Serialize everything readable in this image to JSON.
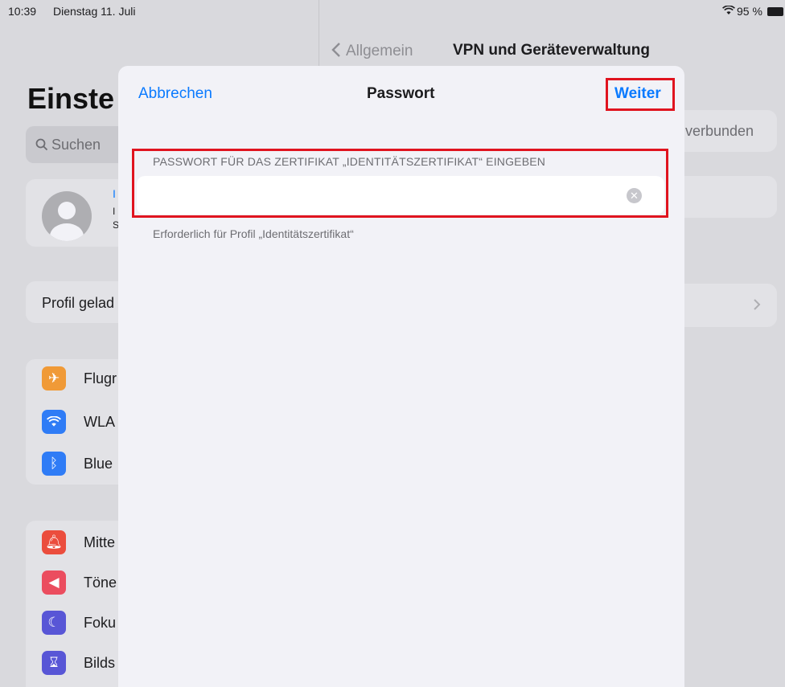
{
  "status_bar": {
    "time": "10:39",
    "date": "Dienstag 11. Juli",
    "battery": "95 %"
  },
  "sidebar": {
    "title": "Einste",
    "search_placeholder": "Suchen",
    "profile_line1": "I",
    "profile_line2": "I",
    "profile_line3": "S",
    "profile_loaded": "Profil gelad",
    "items_group1": [
      {
        "label": "Flugr",
        "icon": "airplane-icon",
        "color": "#f09a37"
      },
      {
        "label": "WLA",
        "icon": "wifi-icon",
        "color": "#2f7cf6"
      },
      {
        "label": "Blue",
        "icon": "bluetooth-icon",
        "color": "#2f7cf6"
      }
    ],
    "items_group2": [
      {
        "label": "Mitte",
        "icon": "bell-icon",
        "color": "#eb4d3d"
      },
      {
        "label": "Töne",
        "icon": "speaker-icon",
        "color": "#eb4d5f"
      },
      {
        "label": "Foku",
        "icon": "moon-icon",
        "color": "#5856d6"
      },
      {
        "label": "Bilds",
        "icon": "hourglass-icon",
        "color": "#5856d6"
      }
    ]
  },
  "detail": {
    "back_label": "Allgemein",
    "title": "VPN und Geräteverwaltung",
    "status_partial": "verbunden"
  },
  "modal": {
    "cancel_label": "Abbrechen",
    "title": "Passwort",
    "next_label": "Weiter",
    "section_header": "PASSWORT FÜR DAS ZERTIFIKAT „IDENTITÄTSZERTIFIKAT“ EINGEBEN",
    "password_value": "",
    "footer_note": "Erforderlich für Profil „Identitätszertifikat“"
  },
  "colors": {
    "accent": "#0a7aff",
    "highlight": "#e0141f"
  }
}
